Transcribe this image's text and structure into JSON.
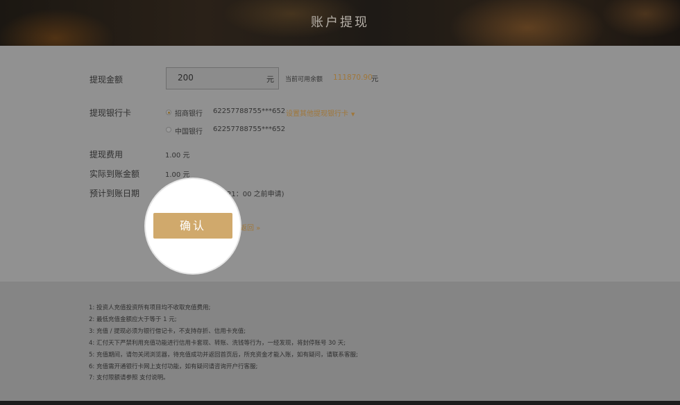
{
  "header": {
    "title": "账户提现"
  },
  "form": {
    "amount_label": "提现金额",
    "amount_value": "200",
    "amount_unit": "元",
    "balance_label": "当前可用余额",
    "balance_value": "111870.90",
    "balance_unit": "元",
    "card_label": "提现银行卡",
    "banks": [
      {
        "name": "招商银行",
        "card": "62257788755***652",
        "selected": true
      },
      {
        "name": "中国银行",
        "card": "62257788755***652",
        "selected": false
      }
    ],
    "other_card_link": "设置其他提现银行卡",
    "fee_label": "提现费用",
    "fee_value": "1.00 元",
    "actual_label": "实际到账金额",
    "actual_value": "1.00 元",
    "date_label": "预计到账日期",
    "date_value_visible": "21：00 之前申请)",
    "confirm_label": "确认",
    "back_link": "返回 »"
  },
  "notes": [
    "1: 投资人充值投资所有项目均不收取充值费用;",
    "2: 最低充值金额应大于等于 1 元;",
    "3: 充值 / 提现必须为银行借记卡，不支持存折、信用卡充值;",
    "4: 汇付天下严禁利用充值功能进行信用卡套现、转账、洗钱等行为，一经发现，将封停账号 30 天;",
    "5: 充值期间，请勿关闭浏览器，待充值成功并返回首页后，所充资金才能入账，如有疑问，请联系客服;",
    "6: 充值需开通银行卡网上支付功能，如有疑问请咨询开户行客服;",
    "7: 支付限额请参照 支付说明。"
  ],
  "colors": {
    "accent": "#d0a96c",
    "link": "#a0773a",
    "highlight": "#ffffff"
  }
}
